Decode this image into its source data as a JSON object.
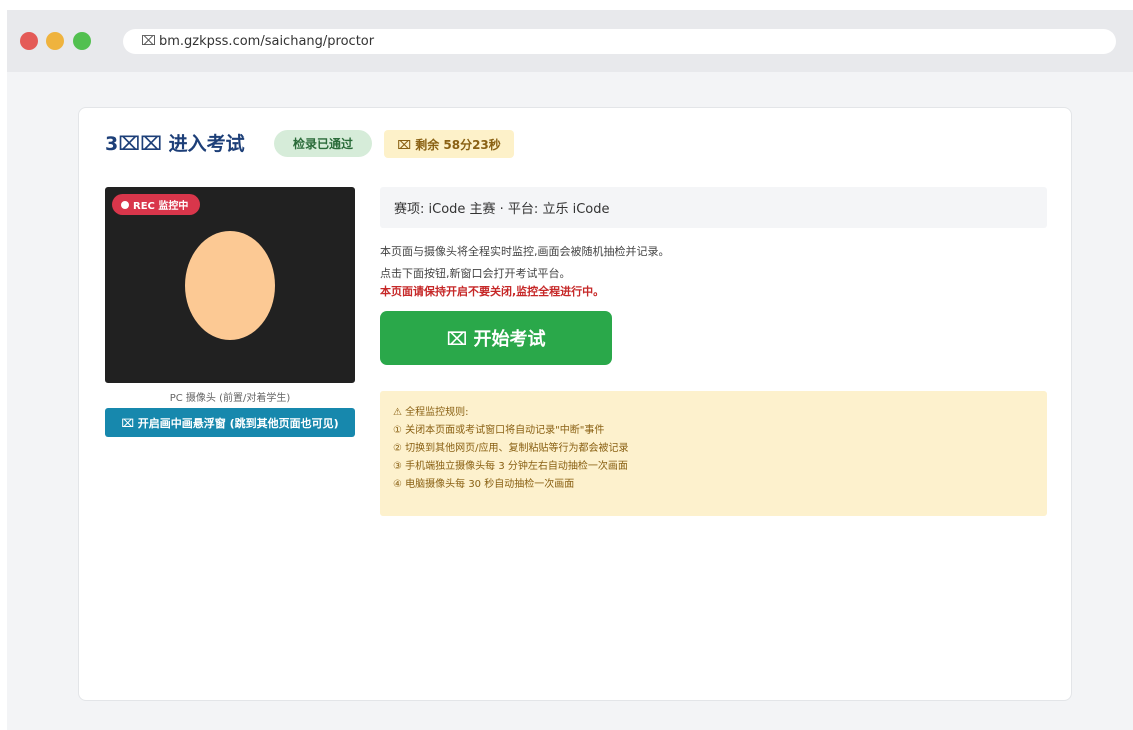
{
  "browser": {
    "url": "bm.gzkpss.com/saichang/proctor",
    "url_icon": "page-icon"
  },
  "header": {
    "title": "3⌧⌧ 进入考试",
    "status_badge": "检录已通过",
    "timer_badge": "⌧ 剩余 58分23秒"
  },
  "camera": {
    "rec_label": "REC 监控中",
    "caption": "PC 摄像头 (前置/对着学生)",
    "pip_button": "⌧ 开启画中画悬浮窗 (跳到其他页面也可见)"
  },
  "info": {
    "event_line": "赛项: iCode 主赛 · 平台: 立乐 iCode"
  },
  "description": {
    "line1": "本页面与摄像头将全程实时监控,画面会被随机抽检并记录。",
    "line2": "点击下面按钮,新窗口会打开考试平台。",
    "warning": "本页面请保持开启不要关闭,监控全程进行中。"
  },
  "start_button": "⌧ 开始考试",
  "rules": {
    "title": "⚠ 全程监控规则:",
    "items": [
      "① 关闭本页面或考试窗口将自动记录\"中断\"事件",
      "② 切换到其他网页/应用、复制粘贴等行为都会被记录",
      "③ 手机端独立摄像头每 3 分钟左右自动抽检一次画面",
      "④ 电脑摄像头每 30 秒自动抽检一次画面"
    ]
  },
  "colors": {
    "title": "#1d3f78",
    "start_button": "#2aa84a",
    "pip_button": "#1788ad",
    "rec_badge": "#d9364b",
    "warning_text": "#c62828"
  }
}
